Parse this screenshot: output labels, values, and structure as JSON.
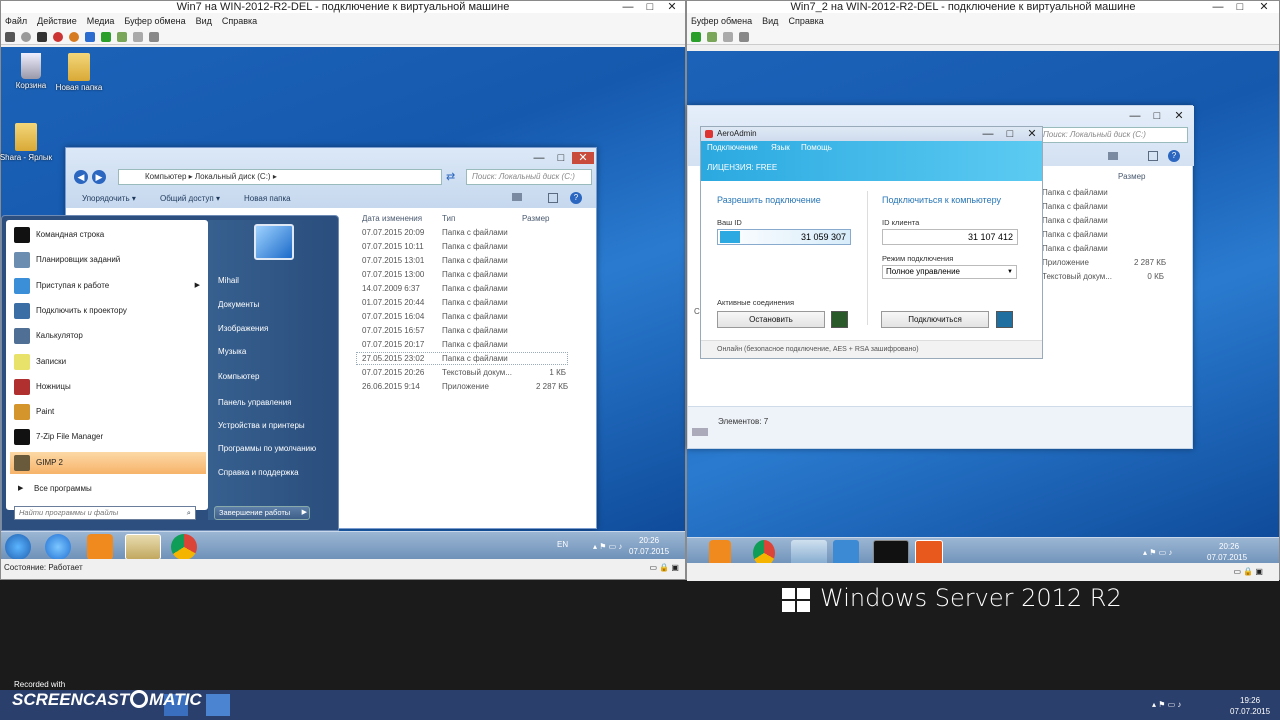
{
  "vm1": {
    "title": "Win7 на WIN-2012-R2-DEL - подключение к виртуальной машине",
    "menu": [
      "Файл",
      "Действие",
      "Медиа",
      "Буфер обмена",
      "Вид",
      "Справка"
    ],
    "status": "Состояние: Работает"
  },
  "vm2": {
    "title": "Win7_2 на WIN-2012-R2-DEL - подключение к виртуальной машине",
    "menu": [
      "Буфер обмена",
      "Вид",
      "Справка"
    ]
  },
  "desktop_icons": [
    {
      "label": "Корзина",
      "icon": "recycle-bin-icon"
    },
    {
      "label": "Новая папка",
      "icon": "folder-icon"
    },
    {
      "label": "Shara - Ярлык",
      "icon": "folder-shortcut-icon"
    }
  ],
  "explorer": {
    "breadcrumb": [
      "Компьютер",
      "Локальный диск (C:)"
    ],
    "search_placeholder": "Поиск: Локальный диск (C:)",
    "commands": [
      "Упорядочить ▾",
      "Общий доступ ▾",
      "Новая папка"
    ],
    "columns": [
      "Дата изменения",
      "Тип",
      "Размер"
    ],
    "rows": [
      {
        "date": "07.07.2015 20:09",
        "type": "Папка с файлами",
        "size": ""
      },
      {
        "date": "07.07.2015 10:11",
        "type": "Папка с файлами",
        "size": ""
      },
      {
        "date": "07.07.2015 13:01",
        "type": "Папка с файлами",
        "size": ""
      },
      {
        "date": "07.07.2015 13:00",
        "type": "Папка с файлами",
        "size": ""
      },
      {
        "date": "14.07.2009 6:37",
        "type": "Папка с файлами",
        "size": ""
      },
      {
        "date": "01.07.2015 20:44",
        "type": "Папка с файлами",
        "size": ""
      },
      {
        "date": "07.07.2015 16:04",
        "type": "Папка с файлами",
        "size": ""
      },
      {
        "date": "07.07.2015 16:57",
        "type": "Папка с файлами",
        "size": ""
      },
      {
        "date": "07.07.2015 20:17",
        "type": "Папка с файлами",
        "size": ""
      },
      {
        "date": "27.05.2015 23:02",
        "type": "Папка с файлами",
        "size": ""
      },
      {
        "date": "07.07.2015 20:26",
        "type": "Текстовый докум...",
        "size": "1 КБ"
      },
      {
        "date": "26.06.2015 9:14",
        "type": "Приложение",
        "size": "2 287 КБ"
      }
    ]
  },
  "start_menu": {
    "programs": [
      {
        "label": "Командная строка",
        "color": "#111"
      },
      {
        "label": "Планировщик заданий",
        "color": "#6b8db0"
      },
      {
        "label": "Приступая к работе",
        "color": "#3a8fd8"
      },
      {
        "label": "Подключить к проектору",
        "color": "#3b6ea5"
      },
      {
        "label": "Калькулятор",
        "color": "#4f6f95"
      },
      {
        "label": "Записки",
        "color": "#e8e16a"
      },
      {
        "label": "Ножницы",
        "color": "#b03030"
      },
      {
        "label": "Paint",
        "color": "#d4952c"
      },
      {
        "label": "7-Zip File Manager",
        "color": "#111"
      },
      {
        "label": "GIMP 2",
        "color": "#6a5a3c"
      }
    ],
    "all_programs": "Все программы",
    "search_placeholder": "Найти программы и файлы",
    "right": [
      "Mihail",
      "Документы",
      "Изображения",
      "Музыка",
      "Компьютер",
      "Панель управления",
      "Устройства и принтеры",
      "Программы по умолчанию",
      "Справка и поддержка"
    ],
    "shutdown": "Завершение работы"
  },
  "tray1": {
    "lang": "EN",
    "time": "20:26",
    "date": "07.07.2015"
  },
  "aeroadmin": {
    "title": "AeroAdmin",
    "menu": [
      "Подключение",
      "Язык",
      "Помощь"
    ],
    "license": "ЛИЦЕНЗИЯ: FREE",
    "allow_title": "Разрешить подключение",
    "your_id_label": "Ваш ID",
    "your_id": "31 059 307",
    "connect_title": "Подключиться к компьютеру",
    "client_id_label": "ID клиента",
    "client_id": "31 107 412",
    "mode_label": "Режим подключения",
    "mode": "Полное управление",
    "active_label": "Активные соединения",
    "stop_btn": "Остановить",
    "connect_btn": "Подключиться",
    "status": "Онлайн (безопасное подключение, AES + RSA зашифровано)"
  },
  "explorer2": {
    "search_placeholder": "Поиск: Локальный диск (C:)",
    "size_col": "Размер",
    "rows": [
      {
        "type": "Папка с файлами",
        "size": ""
      },
      {
        "type": "Папка с файлами",
        "size": ""
      },
      {
        "type": "Папка с файлами",
        "size": ""
      },
      {
        "type": "Папка с файлами",
        "size": ""
      },
      {
        "type": "Папка с файлами",
        "size": ""
      },
      {
        "type": "Приложение",
        "size": "2 287 КБ"
      },
      {
        "type": "Текстовый докум...",
        "size": "0 КБ"
      }
    ],
    "items_count": "Элементов: 7",
    "network": "Сеть"
  },
  "tray2": {
    "time": "20:26",
    "date": "07.07.2015"
  },
  "host": {
    "brand": "Windows Server 2012 R2",
    "recorded_with": "Recorded with",
    "screencast": "SCREENCAST",
    "matic": "MATIC",
    "time": "19:26",
    "date": "07.07.2015"
  }
}
